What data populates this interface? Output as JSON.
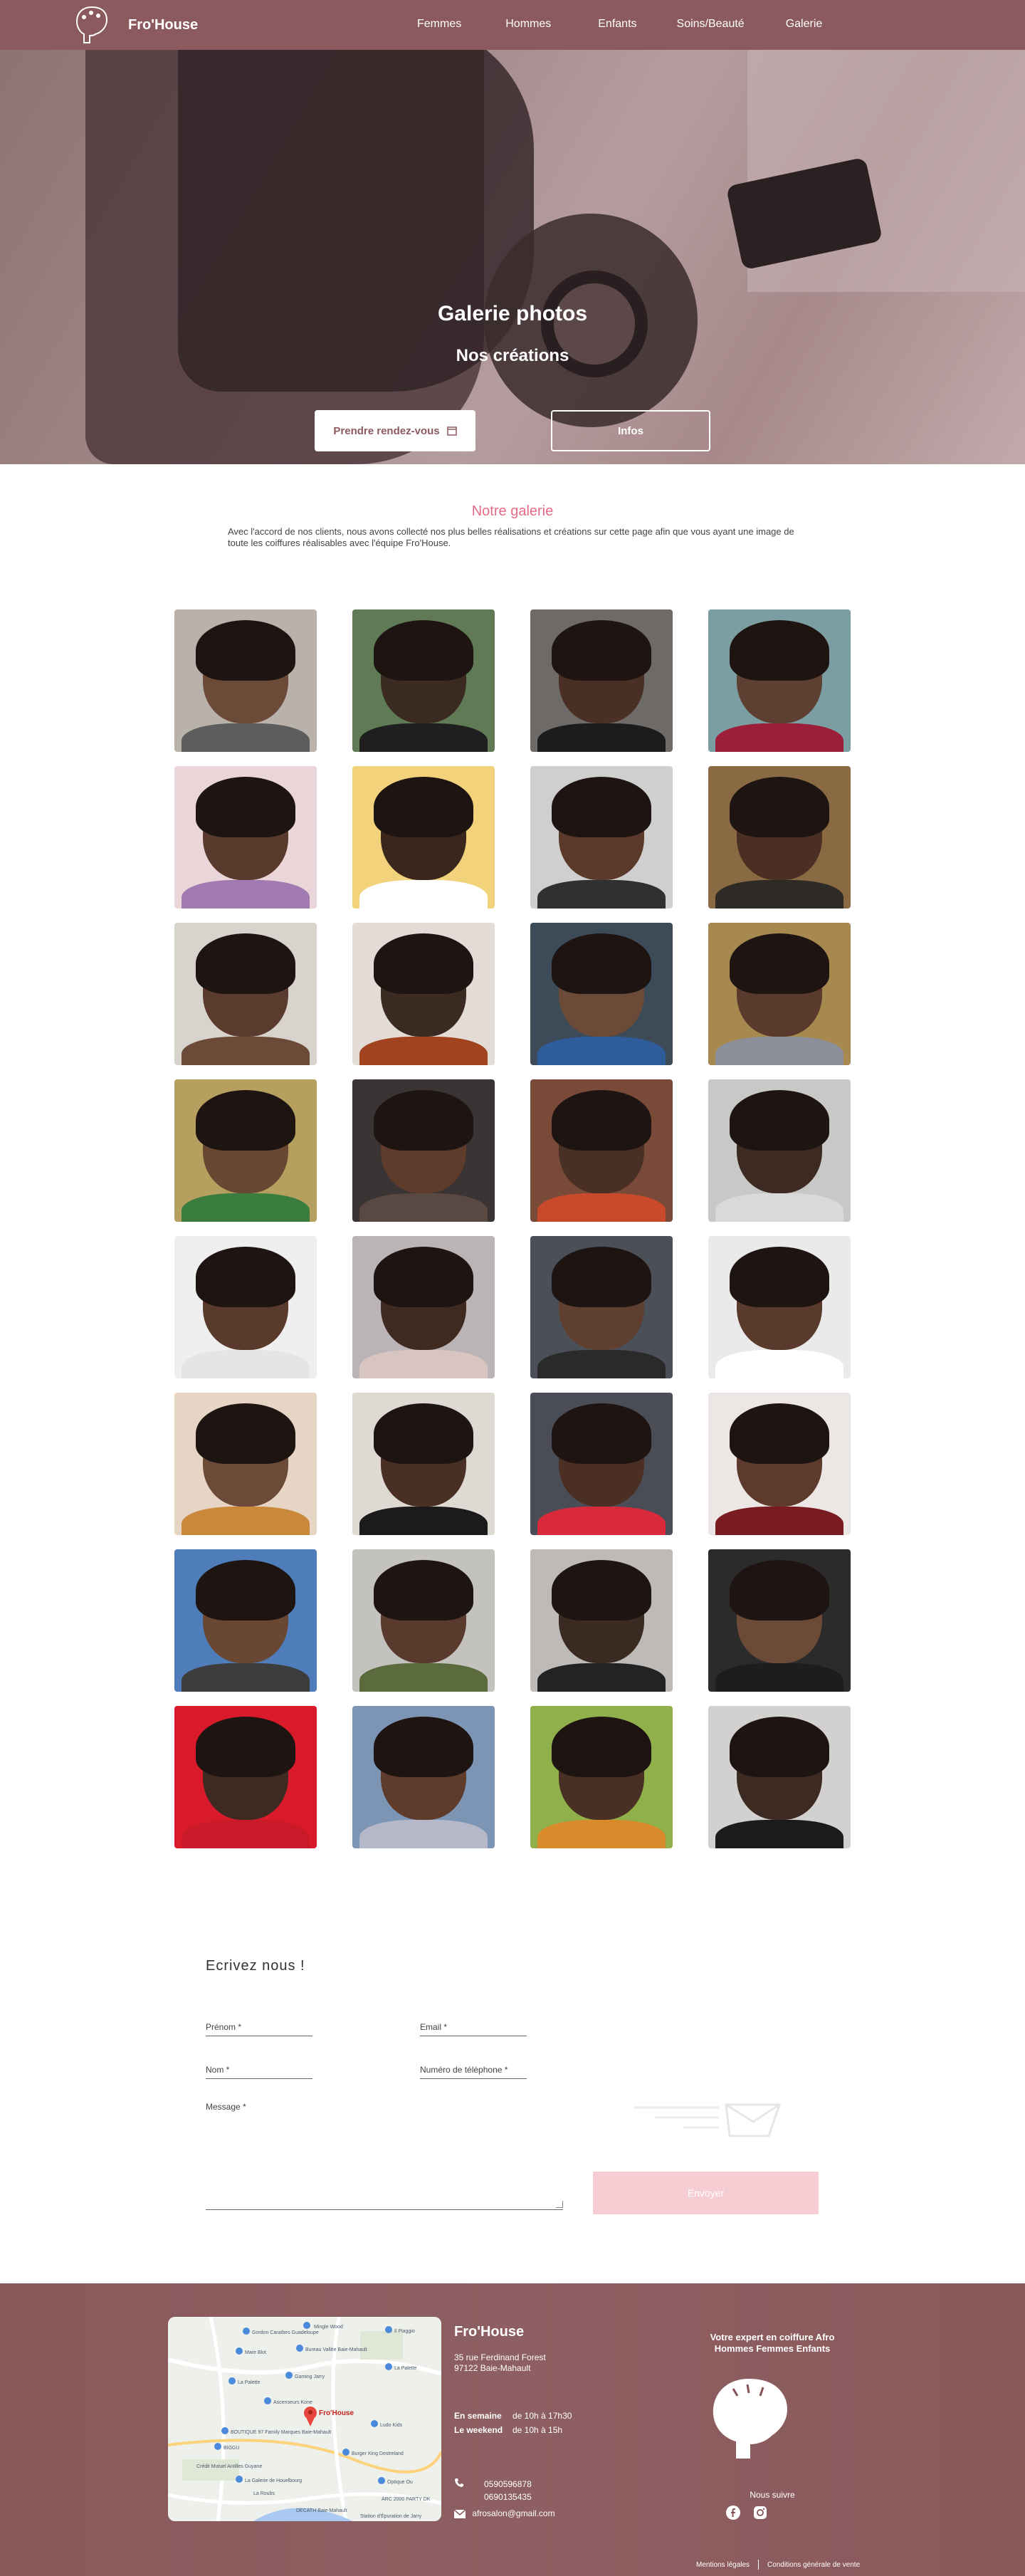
{
  "nav": {
    "brand": "Fro'House",
    "links": [
      "Femmes",
      "Hommes",
      "Enfants",
      "Soins/Beauté",
      "Galerie"
    ]
  },
  "hero": {
    "title": "Galerie photos",
    "subtitle": "Nos créations",
    "btn_rdv": "Prendre rendez-vous",
    "btn_infos": "Infos"
  },
  "gallery": {
    "title": "Notre galerie",
    "description": "Avec l'accord de nos clients, nous avons collecté nos plus belles réalisations et créations sur cette page afin que vous ayant une image de toute les coiffures réalisables avec l'équipe Fro'House.",
    "tiles": [
      {
        "bg": "#b9b2ab",
        "skin": "#6b4a38",
        "cloth": "#5d5d5d"
      },
      {
        "bg": "#5f7a54",
        "skin": "#3b2a22",
        "cloth": "#1f1f1f"
      },
      {
        "bg": "#6d6a68",
        "skin": "#4a2f24",
        "cloth": "#1c1c1c"
      },
      {
        "bg": "#7b9ea3",
        "skin": "#5e4032",
        "cloth": "#9b1f3a"
      },
      {
        "bg": "#ead6d9",
        "skin": "#5b3a2e",
        "cloth": "#a07ab0"
      },
      {
        "bg": "#f2d27a",
        "skin": "#3b261e",
        "cloth": "#ffffff"
      },
      {
        "bg": "#cfcfcf",
        "skin": "#5c3a2b",
        "cloth": "#303030"
      },
      {
        "bg": "#8a6a42",
        "skin": "#4b2f23",
        "cloth": "#2e2a26"
      },
      {
        "bg": "#d9d3ce",
        "skin": "#5a3b2e",
        "cloth": "#6b4a38"
      },
      {
        "bg": "#e3dcd6",
        "skin": "#3b2a22",
        "cloth": "#a2431f"
      },
      {
        "bg": "#3d4a58",
        "skin": "#6b4a38",
        "cloth": "#2f5c9a"
      },
      {
        "bg": "#a7894f",
        "skin": "#5b3a2e",
        "cloth": "#8a8f99"
      },
      {
        "bg": "#b6a060",
        "skin": "#6a4733",
        "cloth": "#3a7d3f"
      },
      {
        "bg": "#3a3434",
        "skin": "#5e3b2b",
        "cloth": "#5a4842"
      },
      {
        "bg": "#7a4a39",
        "skin": "#4a2f24",
        "cloth": "#c94a2a"
      },
      {
        "bg": "#c8c8c6",
        "skin": "#3d2a22",
        "cloth": "#d9d9d9"
      },
      {
        "bg": "#efefef",
        "skin": "#5b3a2e",
        "cloth": "#e5e5e5"
      },
      {
        "bg": "#bbb4b6",
        "skin": "#3f2a22",
        "cloth": "#d8c5c2"
      },
      {
        "bg": "#4b4f58",
        "skin": "#5f3f2f",
        "cloth": "#2a2a2a"
      },
      {
        "bg": "#eaeaea",
        "skin": "#5b3a2e",
        "cloth": "#ffffff"
      },
      {
        "bg": "#e6d4c4",
        "skin": "#6b4a38",
        "cloth": "#c9883a"
      },
      {
        "bg": "#ded9d2",
        "skin": "#4a2f24",
        "cloth": "#1b1b1b"
      },
      {
        "bg": "#4a4d55",
        "skin": "#4b2f23",
        "cloth": "#d92a3b"
      },
      {
        "bg": "#ece6e4",
        "skin": "#5d3a2b",
        "cloth": "#7a1b22"
      },
      {
        "bg": "#4f7db9",
        "skin": "#6a4733",
        "cloth": "#3d3d3d"
      },
      {
        "bg": "#c4c2be",
        "skin": "#5b3a2e",
        "cloth": "#5b6b3e"
      },
      {
        "bg": "#bdbab7",
        "skin": "#3b2a22",
        "cloth": "#232323"
      },
      {
        "bg": "#2b2b2b",
        "skin": "#6b4a38",
        "cloth": "#1d1d1d"
      },
      {
        "bg": "#d91a2a",
        "skin": "#3f2a22",
        "cloth": "#c81a28"
      },
      {
        "bg": "#7d95b5",
        "skin": "#5e3b2b",
        "cloth": "#b5b8c8"
      },
      {
        "bg": "#8fb04a",
        "skin": "#4a2f24",
        "cloth": "#d98a2a"
      },
      {
        "bg": "#d2d1d0",
        "skin": "#3d2a22",
        "cloth": "#1b1b1b"
      }
    ]
  },
  "form": {
    "title": "Ecrivez nous !",
    "prenom": "Prénom *",
    "email": "Email *",
    "nom": "Nom *",
    "telephone": "Numéro de téléphone *",
    "message": "Message *",
    "send": "Envoyer"
  },
  "footer": {
    "brand": "Fro'House",
    "address_line1": "35 rue Ferdinand Forest",
    "address_line2": "97122 Baie-Mahault",
    "weekday_label": "En semaine",
    "weekday_hours": "de 10h à 17h30",
    "weekend_label": "Le weekend",
    "weekend_hours": "de 10h à 15h",
    "phone1": "0590596878",
    "phone2": "0690135435",
    "email": "afrosalon@gmail.com",
    "tagline_line1": "Votre expert en coiffure Afro",
    "tagline_line2": "Hommes Femmes Enfants",
    "follow": "Nous suivre",
    "legal1": "Mentions légales",
    "legal2": "Conditions générale de vente",
    "map_labels": [
      "Gordon Caraïbes Guadeloupe",
      "Mingle Wood",
      "Il Piaggio",
      "Mare Blot",
      "Bureau Vallée Baie-Mahault",
      "La Palette",
      "Gaming Jarry",
      "La Palette",
      "Ascenseurs Kone",
      "BOUTIQUE 97 Family Marques Baie-Mahault",
      "Ludo Kids",
      "BIGGU",
      "Burger King Destreland",
      "La Galerie de Houelbourg",
      "Fro'House",
      "Optique Ou",
      "Crédit Mutuel Antilles Guyane",
      "La Roubs",
      "DECATH Baie-Mahault",
      "ARC 2000 PARTY DK",
      "Station d'Épuration de Jarry"
    ],
    "colors": {
      "accent": "#855356",
      "nav": "#8b5a5f",
      "pink": "#e76b84"
    }
  }
}
